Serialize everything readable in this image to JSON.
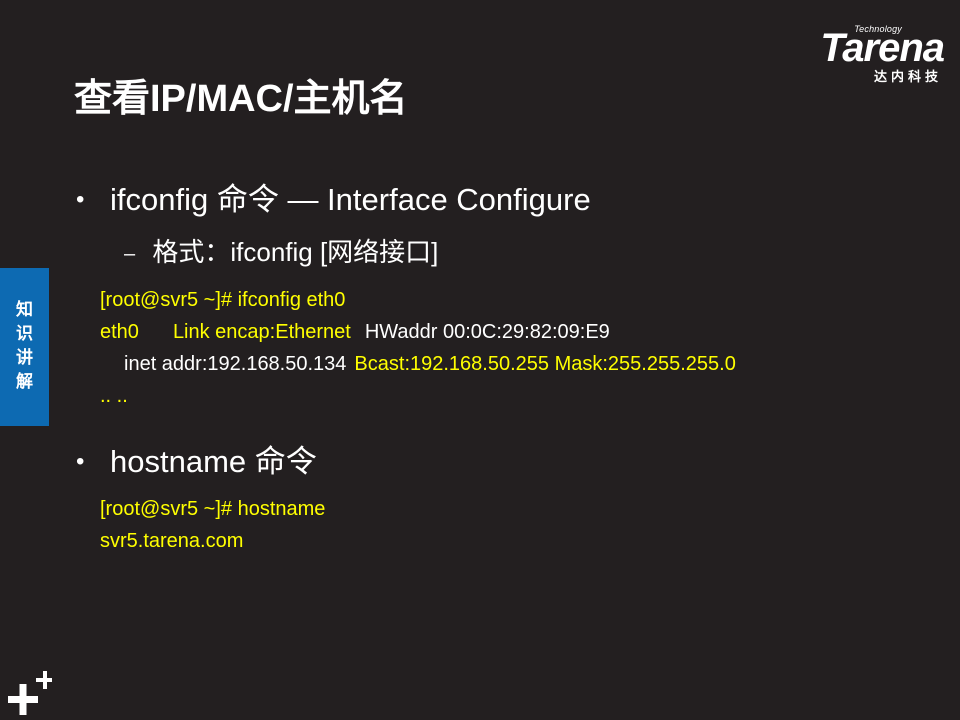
{
  "logo": {
    "technology": "Technology",
    "brand": "Tarena",
    "subtitle": "达内科技"
  },
  "slide": {
    "title": "查看IP/MAC/主机名"
  },
  "side_tab": {
    "text": "知识讲解"
  },
  "bullets": [
    {
      "text": "ifconfig 命令 — Interface Configure",
      "sub": "格式：ifconfig   [网络接口]"
    },
    {
      "text": "hostname 命令"
    }
  ],
  "code1": {
    "line1": "[root@svr5 ~]# ifconfig  eth0",
    "line2_a": "eth0",
    "line2_b": "Link encap:Ethernet",
    "line2_c": "HWaddr 00:0C:29:82:09:E9",
    "line3_a": "inet addr:192.168.50.134",
    "line3_b": "Bcast:192.168.50.255  Mask:255.255.255.0",
    "line4": ".. .."
  },
  "code2": {
    "line1": "[root@svr5 ~]# hostname",
    "line2": "svr5.tarena.com"
  },
  "colors": {
    "background": "#231f20",
    "highlight": "#ffff00",
    "side_tab": "#0d6ab2"
  }
}
